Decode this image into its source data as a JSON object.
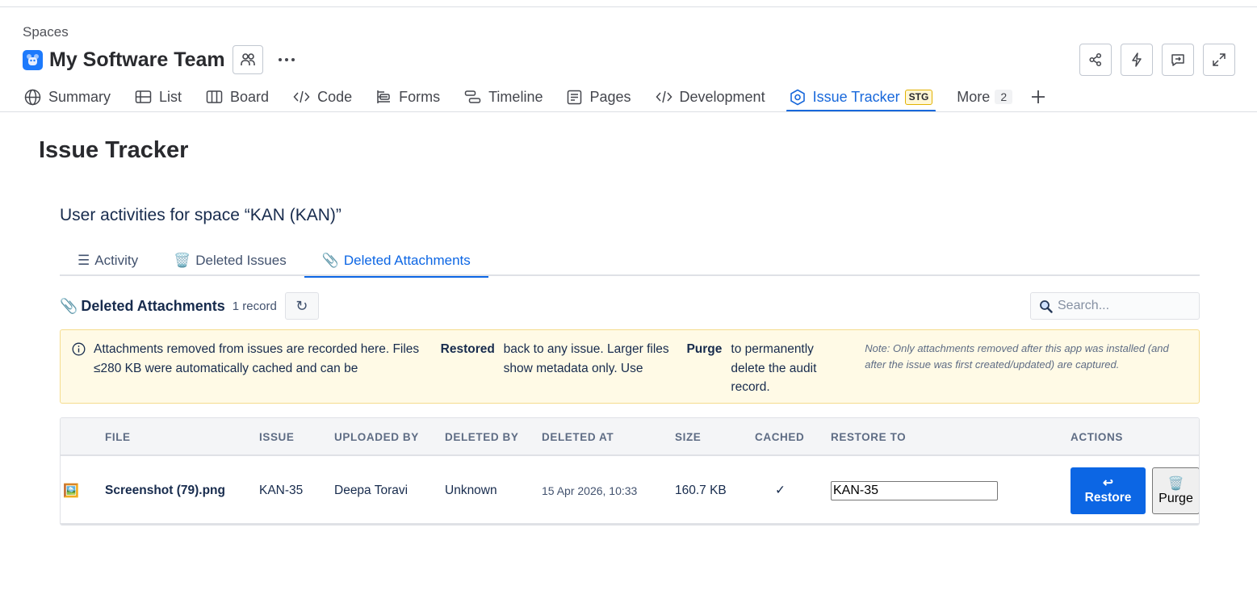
{
  "breadcrumb": "Spaces",
  "space": {
    "title": "My Software Team"
  },
  "nav": {
    "items": [
      {
        "label": "Summary",
        "icon": "globe-icon"
      },
      {
        "label": "List",
        "icon": "list-icon"
      },
      {
        "label": "Board",
        "icon": "board-icon"
      },
      {
        "label": "Code",
        "icon": "code-icon"
      },
      {
        "label": "Forms",
        "icon": "forms-icon"
      },
      {
        "label": "Timeline",
        "icon": "timeline-icon"
      },
      {
        "label": "Pages",
        "icon": "pages-icon"
      },
      {
        "label": "Development",
        "icon": "code-icon"
      },
      {
        "label": "Issue Tracker",
        "icon": "hexagon-icon",
        "badge": "STG",
        "active": true
      },
      {
        "label": "More",
        "count": "2"
      }
    ]
  },
  "page": {
    "title": "Issue Tracker"
  },
  "section": {
    "heading": "User activities for space “KAN (KAN)”"
  },
  "subtabs": [
    {
      "glyph": "☰",
      "label": "Activity"
    },
    {
      "glyph": "🗑️",
      "label": "Deleted Issues"
    },
    {
      "glyph": "📎",
      "label": "Deleted Attachments",
      "active": true
    }
  ],
  "toolbar": {
    "glyph": "📎",
    "title": "Deleted Attachments",
    "count": "1 record",
    "refresh_glyph": "↻",
    "search_placeholder": "Search..."
  },
  "notice": {
    "part1": "Attachments removed from issues are recorded here. Files ≤280 KB were automatically cached and can be",
    "bold1": "Restored",
    "part2": "back to any issue. Larger files show metadata only. Use",
    "bold2": "Purge",
    "part3": "to permanently delete the audit record.",
    "note": "Note: Only attachments removed after this app was installed (and after the issue was first created/updated) are captured."
  },
  "table": {
    "headers": [
      "FILE",
      "ISSUE",
      "UPLOADED BY",
      "DELETED BY",
      "DELETED AT",
      "SIZE",
      "CACHED",
      "RESTORE TO",
      "ACTIONS"
    ],
    "rows": [
      {
        "file_icon": "🖼️",
        "file": "Screenshot (79).png",
        "issue": "KAN-35",
        "uploaded_by": "Deepa Toravi",
        "deleted_by": "Unknown",
        "deleted_at": "15 Apr 2026, 10:33",
        "size": "160.7 KB",
        "cached": "✓",
        "restore_to": "KAN-35",
        "restore_glyph": "↩",
        "restore_label": "Restore",
        "purge_glyph": "🗑️",
        "purge_label": "Purge"
      }
    ]
  },
  "colors": {
    "accent": "#1868db",
    "button_primary": "#0c66e4",
    "notice_bg": "#fffae6"
  }
}
